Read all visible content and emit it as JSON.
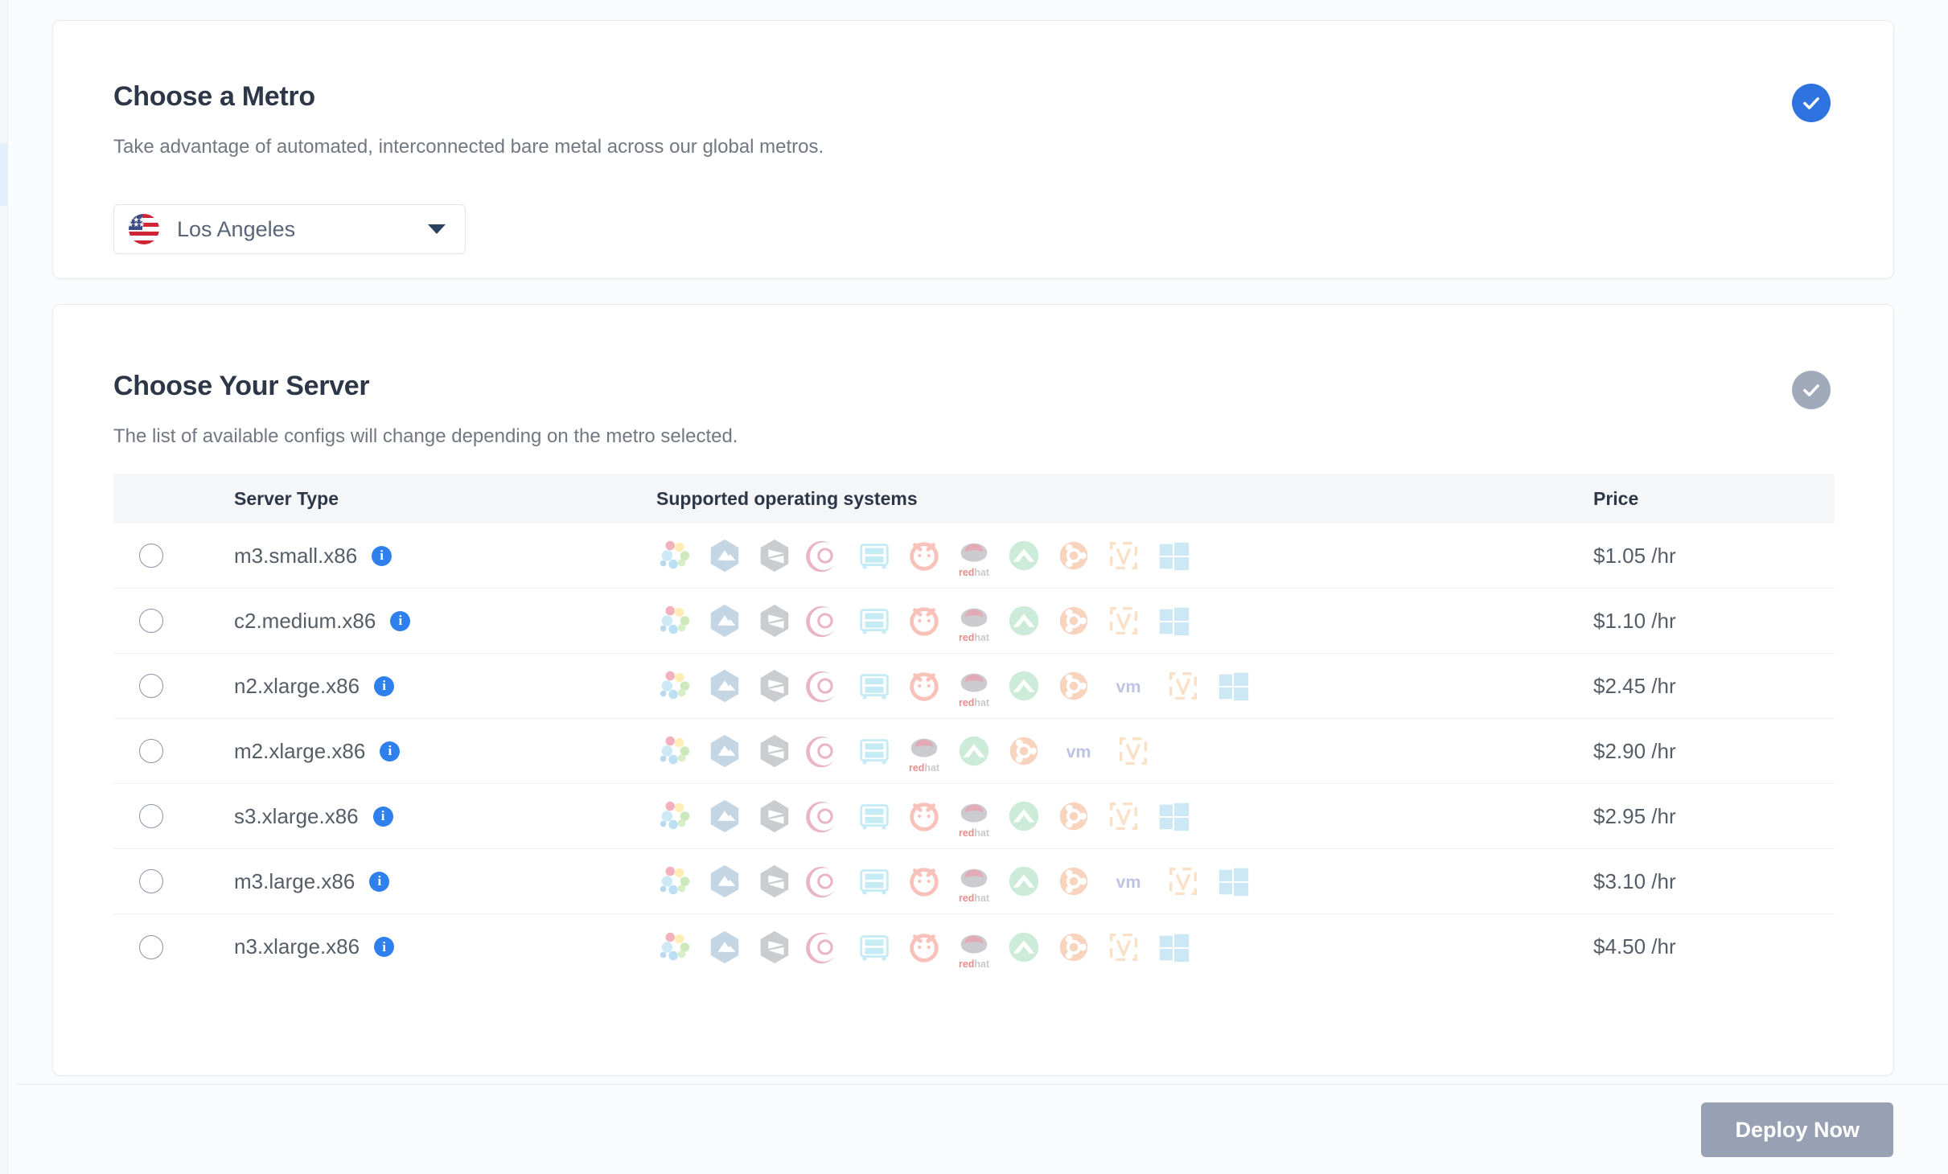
{
  "metro_section": {
    "title": "Choose a Metro",
    "subtitle": "Take advantage of automated, interconnected bare metal across our global metros.",
    "status": "complete",
    "status_color": "#2f73e0",
    "selected_metro": "Los Angeles",
    "flag": "us-flag-icon"
  },
  "server_section": {
    "title": "Choose Your Server",
    "subtitle": "The list of available configs will change depending on the metro selected.",
    "status": "incomplete",
    "status_color": "#a0aabb",
    "table": {
      "headers": {
        "radio": "",
        "server_type": "Server Type",
        "operating_systems": "Supported operating systems",
        "price": "Price"
      },
      "rows": [
        {
          "server_type": "m3.small.x86",
          "price": "$1.05 /hr",
          "selected": false,
          "os": [
            "almalinux",
            "rockylinux-alt",
            "centos",
            "debian",
            "flatcar",
            "freebsd",
            "redhat",
            "rocky",
            "ubuntu",
            "vyos",
            "windows"
          ]
        },
        {
          "server_type": "c2.medium.x86",
          "price": "$1.10 /hr",
          "selected": false,
          "os": [
            "almalinux",
            "rockylinux-alt",
            "centos",
            "debian",
            "flatcar",
            "freebsd",
            "redhat",
            "rocky",
            "ubuntu",
            "vyos",
            "windows"
          ]
        },
        {
          "server_type": "n2.xlarge.x86",
          "price": "$2.45 /hr",
          "selected": false,
          "os": [
            "almalinux",
            "rockylinux-alt",
            "centos",
            "debian",
            "flatcar",
            "freebsd",
            "redhat",
            "rocky",
            "ubuntu",
            "vmware",
            "vyos",
            "windows"
          ]
        },
        {
          "server_type": "m2.xlarge.x86",
          "price": "$2.90 /hr",
          "selected": false,
          "os": [
            "almalinux",
            "rockylinux-alt",
            "centos",
            "debian",
            "flatcar",
            "redhat",
            "rocky",
            "ubuntu",
            "vmware",
            "vyos"
          ]
        },
        {
          "server_type": "s3.xlarge.x86",
          "price": "$2.95 /hr",
          "selected": false,
          "os": [
            "almalinux",
            "rockylinux-alt",
            "centos",
            "debian",
            "flatcar",
            "freebsd",
            "redhat",
            "rocky",
            "ubuntu",
            "vyos",
            "windows"
          ]
        },
        {
          "server_type": "m3.large.x86",
          "price": "$3.10 /hr",
          "selected": false,
          "os": [
            "almalinux",
            "rockylinux-alt",
            "centos",
            "debian",
            "flatcar",
            "freebsd",
            "redhat",
            "rocky",
            "ubuntu",
            "vmware",
            "vyos",
            "windows"
          ]
        },
        {
          "server_type": "n3.xlarge.x86",
          "price": "$4.50 /hr",
          "selected": false,
          "os": [
            "almalinux",
            "rockylinux-alt",
            "centos",
            "debian",
            "flatcar",
            "freebsd",
            "redhat",
            "rocky",
            "ubuntu",
            "vyos",
            "windows"
          ]
        }
      ]
    }
  },
  "footer": {
    "deploy_label": "Deploy Now",
    "deploy_enabled": false,
    "deploy_color": "#98a1b3"
  }
}
